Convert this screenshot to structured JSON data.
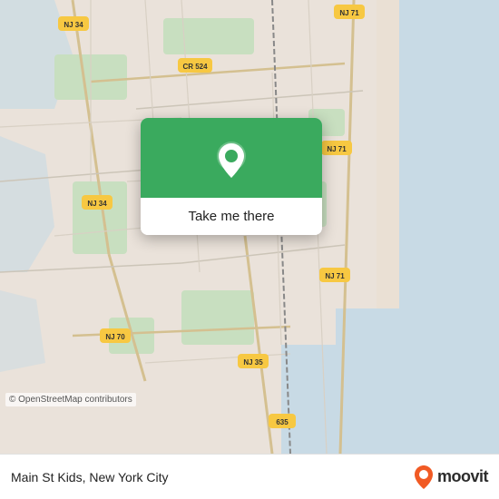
{
  "map": {
    "background_color": "#e8ddd0",
    "attribution": "© OpenStreetMap contributors"
  },
  "popup": {
    "button_label": "Take me there",
    "pin_icon": "location-pin"
  },
  "bottom_bar": {
    "title": "Main St Kids, New York City",
    "logo_text": "moovit"
  },
  "routes": [
    {
      "id": "NJ 71 top",
      "label": "NJ 71"
    },
    {
      "id": "NJ 71 mid",
      "label": "NJ 71"
    },
    {
      "id": "NJ 71 bot",
      "label": "NJ 71"
    },
    {
      "id": "NJ 34 top",
      "label": "NJ 34"
    },
    {
      "id": "NJ 34 mid",
      "label": "NJ 34"
    },
    {
      "id": "NJ 35",
      "label": "NJ 35"
    },
    {
      "id": "NJ 70",
      "label": "NJ 70"
    },
    {
      "id": "CR 524",
      "label": "CR 524"
    },
    {
      "id": "635",
      "label": "635"
    }
  ]
}
